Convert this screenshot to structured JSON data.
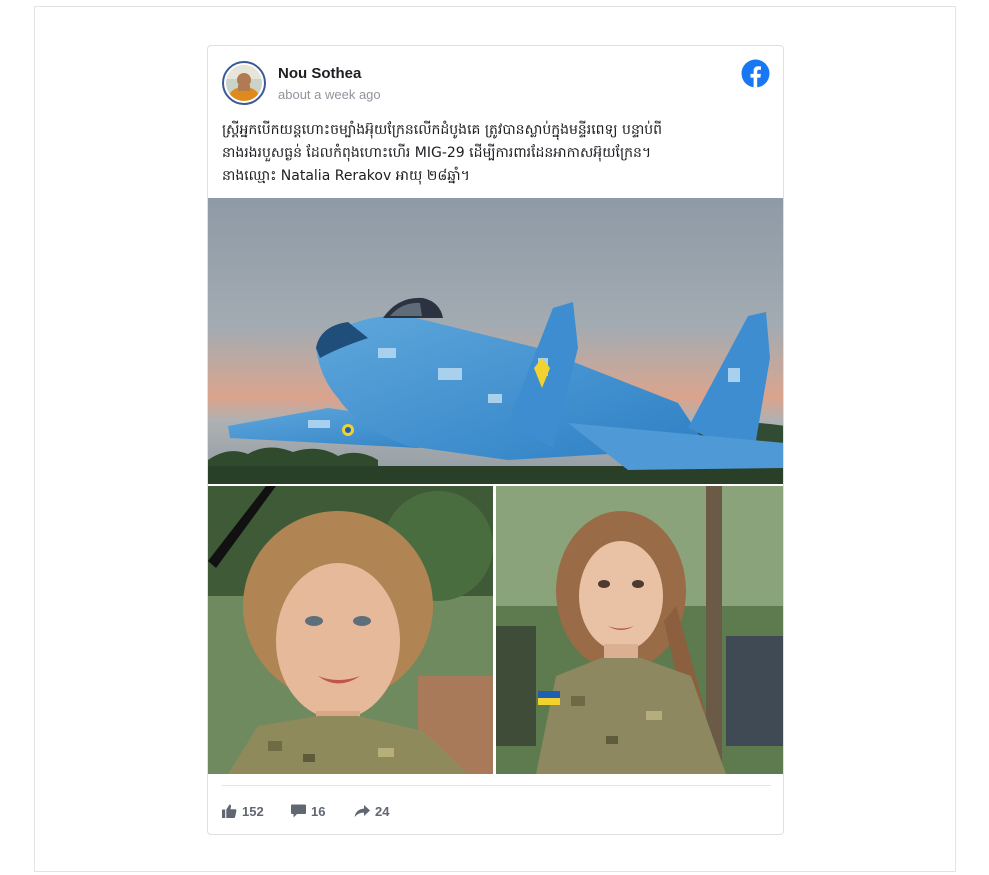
{
  "post": {
    "author": "Nou Sothea",
    "timestamp": "about a week ago",
    "text_lines": [
      "ស្ត្រីអ្នកបើកយន្តហោះចម្បាំងអ៊ុយក្រែនលើកដំបូងគេ ត្រូវបានស្លាប់ក្នុងមន្ទីរពេទ្យ បន្ទាប់ពី",
      "នាងរងរបួសធ្ងន់ ដែលកំពុងហោះហើរ MIG-29 ដើម្បីការពារដែនអាកាសអ៊ុយក្រែន។",
      "នាងឈ្មោះ Natalia Rerakov អាយុ ២៨ឆ្នាំ។"
    ],
    "platform_icon": "facebook-icon",
    "images": [
      {
        "description_icon": "fighter-jet-photo"
      },
      {
        "description_icon": "woman-soldier-portrait-photo"
      },
      {
        "description_icon": "woman-soldier-uniform-photo"
      }
    ]
  },
  "stats": {
    "likes": "152",
    "comments": "16",
    "shares": "24",
    "like_icon": "thumbs-up-icon",
    "comment_icon": "comment-icon",
    "share_icon": "share-arrow-icon"
  },
  "colors": {
    "facebook_blue": "#1877f2",
    "avatar_ring": "#3b5998",
    "meta_text": "#90949c",
    "stat_text": "#606770"
  }
}
